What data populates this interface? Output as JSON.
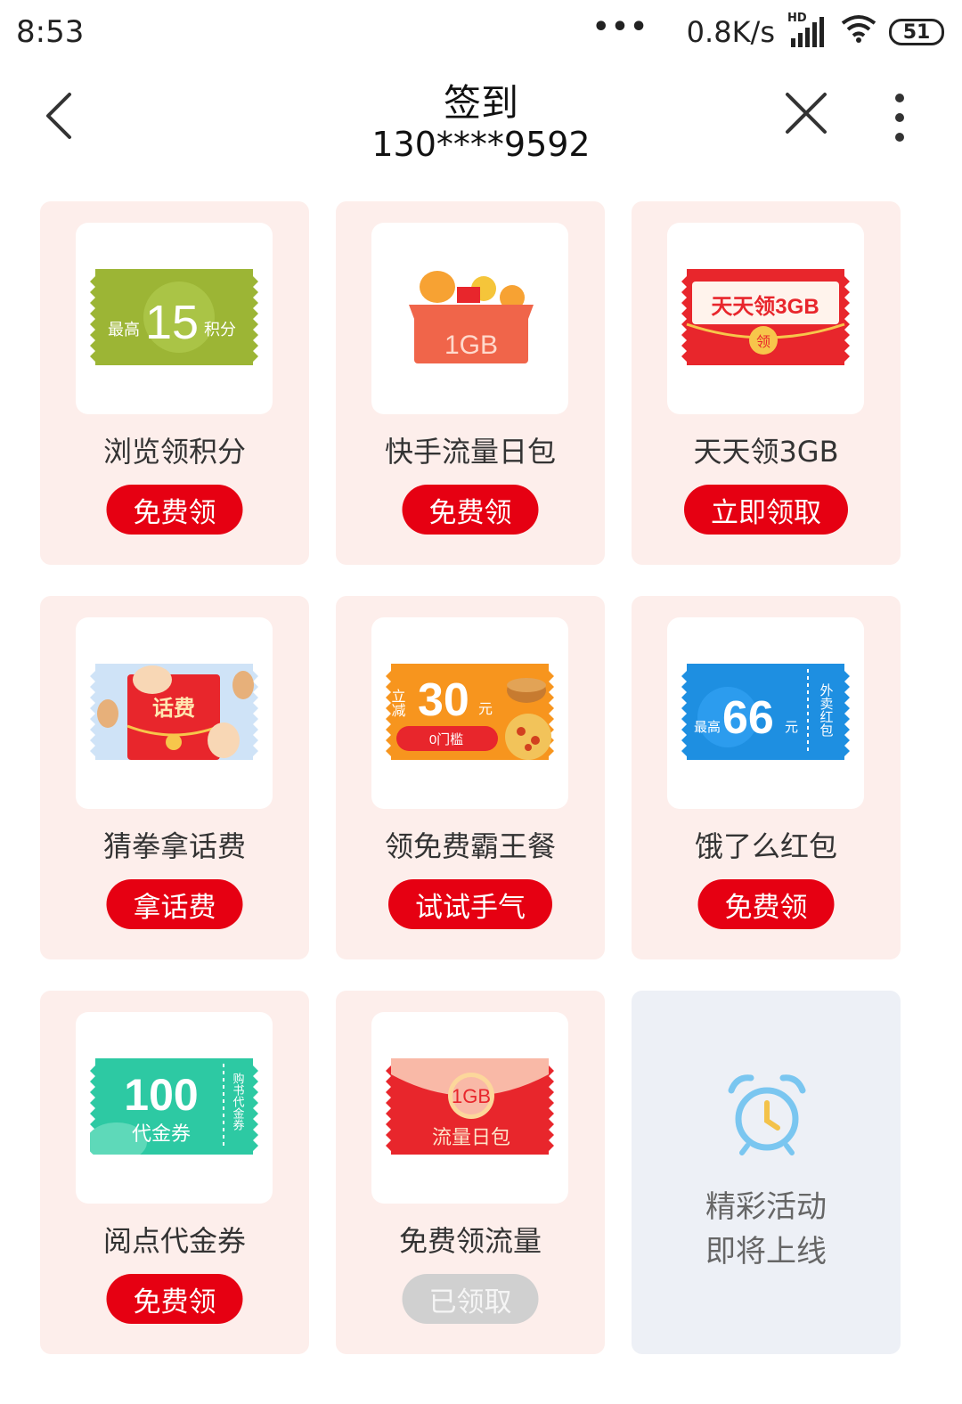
{
  "status": {
    "time": "8:53",
    "dots": "•••",
    "speed": "0.8K/s",
    "signal_label": "HD",
    "battery": "51",
    "icons": [
      "signal-icon",
      "wifi-icon",
      "battery-icon"
    ]
  },
  "nav": {
    "title": "签到",
    "subtitle": "130****9592",
    "icons": [
      "back-arrow-icon",
      "close-icon",
      "more-vertical-icon"
    ]
  },
  "cards": [
    {
      "title": "浏览领积分",
      "button": "免费领",
      "state": "available",
      "art": {
        "prefix": "最高",
        "number": "15",
        "suffix": "积分",
        "color": "#9cb535"
      }
    },
    {
      "title": "快手流量日包",
      "button": "免费领",
      "state": "available",
      "art": {
        "text": "1GB",
        "color": "#f0654a"
      }
    },
    {
      "title": "天天领3GB",
      "button": "立即领取",
      "state": "available",
      "art": {
        "banner": "天天领3GB",
        "seal": "领",
        "color": "#e8262c"
      }
    },
    {
      "title": "猜拳拿话费",
      "button": "拿话费",
      "state": "available",
      "art": {
        "text": "话费",
        "color": "#e8262c"
      }
    },
    {
      "title": "领免费霸王餐",
      "button": "试试手气",
      "state": "available",
      "art": {
        "prefix": "立减",
        "number": "30",
        "suffix": "元",
        "tag": "0门槛",
        "color": "#f7951e"
      }
    },
    {
      "title": "饿了么红包",
      "button": "免费领",
      "state": "available",
      "art": {
        "prefix": "最高",
        "number": "66",
        "suffix": "元",
        "side": "外卖红包",
        "color": "#1e8fe1"
      }
    },
    {
      "title": "阅点代金券",
      "button": "免费领",
      "state": "available",
      "art": {
        "number": "100",
        "label": "代金券",
        "side": "购书代金券",
        "color": "#2dc9a3"
      }
    },
    {
      "title": "免费领流量",
      "button": "已领取",
      "state": "claimed",
      "art": {
        "badge": "1GB",
        "label": "流量日包",
        "color": "#e8262c"
      }
    }
  ],
  "coming_soon": {
    "line1": "精彩活动",
    "line2": "即将上线",
    "icon": "alarm-clock-icon",
    "color": "#7ac6f0"
  },
  "colors": {
    "accent": "#e60012",
    "card_bg": "#fdeeeb",
    "soon_bg": "#edf0f6",
    "disabled": "#d0d0d0"
  }
}
